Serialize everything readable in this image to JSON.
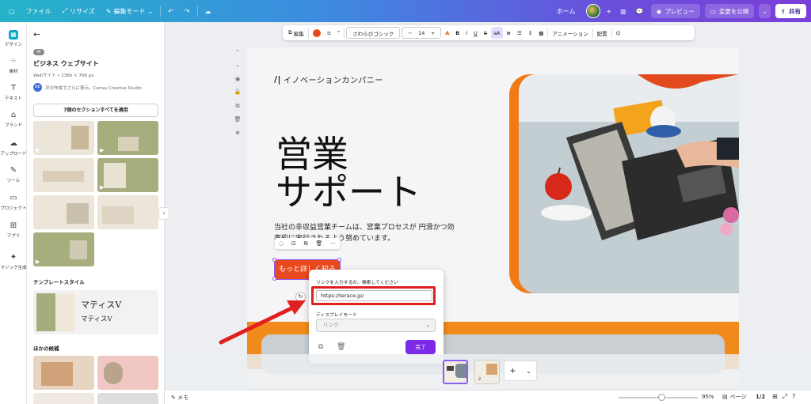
{
  "topbar": {
    "file": "ファイル",
    "resize": "リサイズ",
    "edit_mode": "編集モード",
    "home": "ホーム",
    "preview": "プレビュー",
    "publish": "変更を公開",
    "share": "共有"
  },
  "rail": {
    "items": [
      "デザイン",
      "素材",
      "テキスト",
      "ブランド",
      "アップロード",
      "ツール",
      "プロジェクト",
      "アプリ",
      "マジック生成"
    ]
  },
  "panel": {
    "badge": "W",
    "title": "ビジネス ウェブサイト",
    "subtitle": "Webサイト • 1366 × 768 px",
    "credit_initials": "CC",
    "credit": "次の作成でさらに表示。Canva Creative Studio",
    "apply_all": "7個のセクションすべてを適用",
    "template_style_heading": "テンプレートスタイル",
    "style_sample_1": "マティスV",
    "style_sample_2": "マティスV",
    "other_candidates_heading": "ほかの候補"
  },
  "toolbar": {
    "edit": "編集",
    "font": "さわらびゴシック",
    "font_size": "14",
    "animation": "アニメーション",
    "arrange": "配置"
  },
  "page": {
    "brand": "イノベーションカンパニー",
    "heading_line1": "営業",
    "heading_line2": "サポート",
    "body": "当社の非収益営業チームは、営業プロセスが 円滑かつ効率的に実行されるよう努めています。",
    "cta": "もっと詳しく知る"
  },
  "link_popup": {
    "label": "リンクを入力するか、検索してください",
    "url_value": "https://terace.jp/",
    "display_mode_label": "ディスプレイモード",
    "display_mode_value": "リンク",
    "done": "完了"
  },
  "pages": {
    "page2_num": "2"
  },
  "bottombar": {
    "memo": "メモ",
    "zoom": "95%",
    "pages_label": "ページ",
    "page_count": "1/2"
  },
  "colors": {
    "accent_orange": "#e8491d",
    "canva_purple": "#7d2ae8",
    "highlight_red": "#e02020"
  }
}
